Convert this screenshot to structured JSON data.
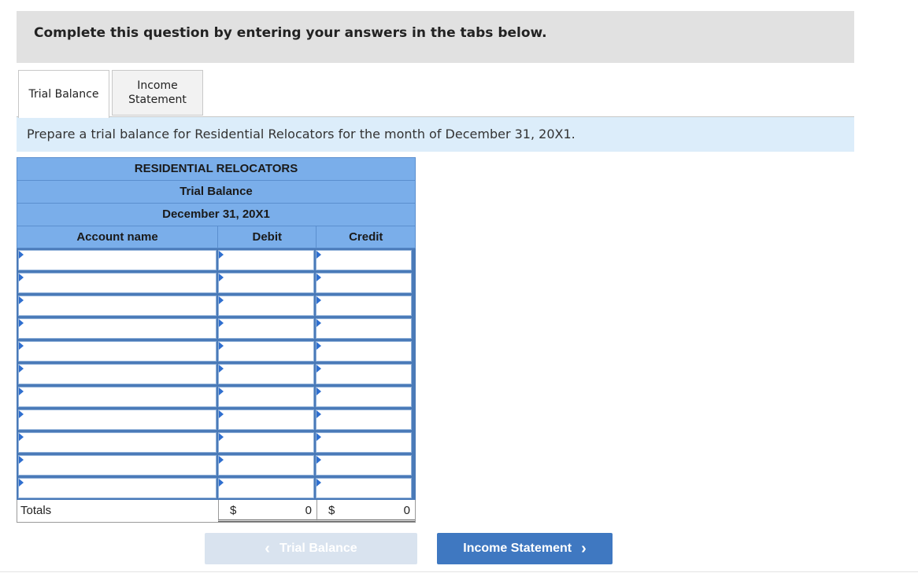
{
  "instructions": "Complete this question by entering your answers in the tabs below.",
  "tabs": [
    {
      "label": "Trial Balance",
      "active": true
    },
    {
      "label": "Income Statement",
      "active": false
    }
  ],
  "prompt": "Prepare a trial balance for Residential Relocators for the month of December 31, 20X1.",
  "table": {
    "company": "RESIDENTIAL RELOCATORS",
    "statement": "Trial Balance",
    "date": "December 31, 20X1",
    "columns": {
      "account": "Account name",
      "debit": "Debit",
      "credit": "Credit"
    },
    "row_count": 11,
    "totals": {
      "label": "Totals",
      "debit_symbol": "$",
      "debit_value": "0",
      "credit_symbol": "$",
      "credit_value": "0"
    }
  },
  "nav": {
    "prev_label": "Trial Balance",
    "next_label": "Income Statement"
  },
  "icons": {
    "prev": "chevron-left-icon",
    "next": "chevron-right-icon",
    "row_marker": "dropdown-triangle-icon"
  },
  "colors": {
    "header_blue": "#7aaeea",
    "next_button": "#3f78c1",
    "prompt_bg": "#dcedfa"
  }
}
